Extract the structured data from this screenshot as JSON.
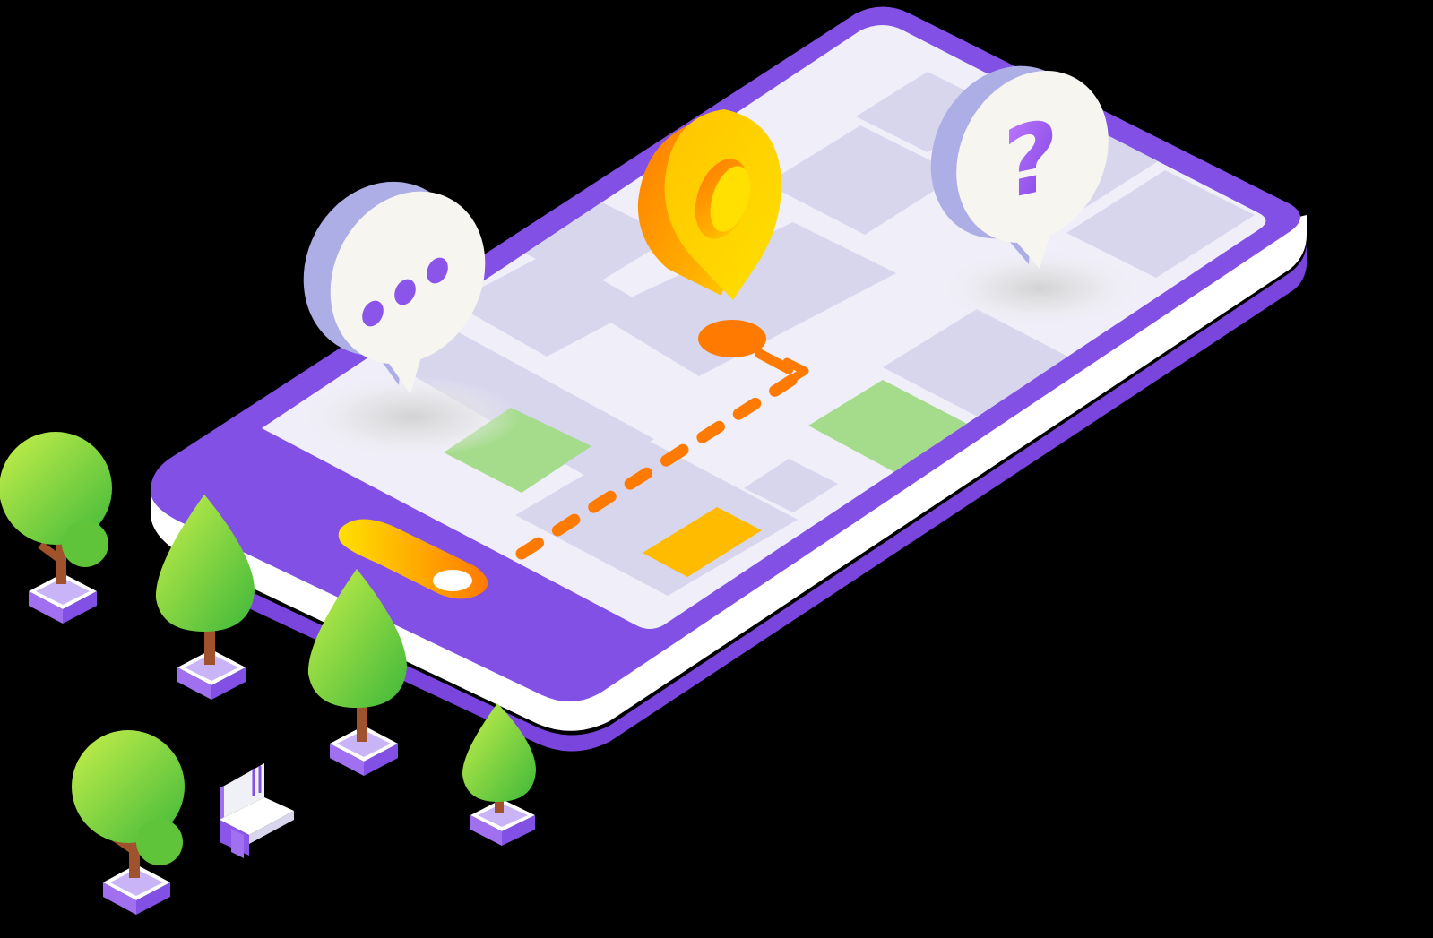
{
  "illustration": {
    "bubble_right": {
      "glyph": "?",
      "icon": "question-mark-icon"
    },
    "bubble_left": {
      "icon": "ellipsis-icon"
    },
    "pin": {
      "icon": "map-pin-icon"
    }
  },
  "colors": {
    "background": "#000000",
    "phone_purple": "#8250e4",
    "phone_edge_white": "#ffffff",
    "map_base": "#efeef9",
    "map_block": "#d8d6ed",
    "park_green": "#a5dc8c",
    "block_yellow": "#ffbb00",
    "route_orange": "#ff7a00",
    "pin_orange": "#ff8a00",
    "pin_yellow": "#ffd400",
    "bubble_cream": "#f7f5ef",
    "bubble_lavender": "#adaee6",
    "dots_purple": "#8a55e8",
    "tree_green": "#7fd43a",
    "tree_trunk": "#a0522d",
    "planter_purple": "#a070f0"
  }
}
